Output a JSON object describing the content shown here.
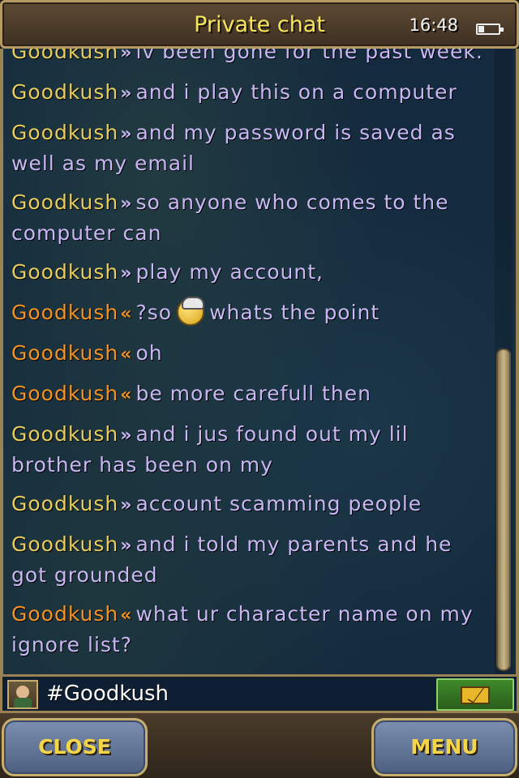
{
  "header": {
    "title": "Private chat",
    "time": "16:48",
    "battery_level": 0.3
  },
  "messages": [
    {
      "sender": "Goodkush",
      "dir": "out",
      "text": "iv been gone for the past week."
    },
    {
      "sender": "Goodkush",
      "dir": "out",
      "text": "and i play this on a computer"
    },
    {
      "sender": "Goodkush",
      "dir": "out",
      "text": "and my password is saved as well as my email"
    },
    {
      "sender": "Goodkush",
      "dir": "out",
      "text": "so anyone who comes to the computer can"
    },
    {
      "sender": "Goodkush",
      "dir": "out",
      "text": "play my account,"
    },
    {
      "sender": "Goodkush",
      "dir": "in",
      "text_before": "?so",
      "emoji": "angel-smiley",
      "text": "whats the point"
    },
    {
      "sender": "Goodkush",
      "dir": "in",
      "text": "oh"
    },
    {
      "sender": "Goodkush",
      "dir": "in",
      "text": "be more carefull then"
    },
    {
      "sender": "Goodkush",
      "dir": "out",
      "text": "and i jus found out my lil brother has been on my"
    },
    {
      "sender": "Goodkush",
      "dir": "out",
      "text": "account scamming people"
    },
    {
      "sender": "Goodkush",
      "dir": "out",
      "text": "and i told my parents and he got grounded"
    },
    {
      "sender": "Goodkush",
      "dir": "in",
      "text": "what ur character name on my ignore list?"
    }
  ],
  "input": {
    "recipient": "#Goodkush",
    "send_icon": "envelope-icon"
  },
  "buttons": {
    "close": "CLOSE",
    "menu": "MENU"
  }
}
